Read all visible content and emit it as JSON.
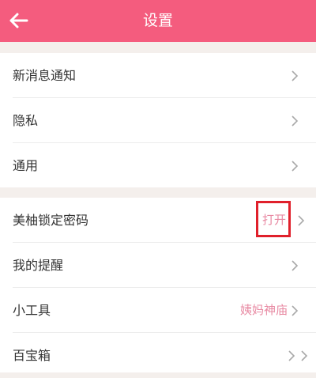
{
  "header": {
    "title": "设置",
    "back_icon": "arrow-left-icon",
    "color": "#f45c7e"
  },
  "groups": [
    {
      "items": [
        {
          "label": "新消息通知"
        },
        {
          "label": "隐私"
        },
        {
          "label": "通用"
        }
      ]
    },
    {
      "items": [
        {
          "label": "美柚锁定密码",
          "value": "打开"
        },
        {
          "label": "我的提醒"
        },
        {
          "label": "小工具",
          "value": "姨妈神庙"
        },
        {
          "label": "百宝箱"
        }
      ]
    }
  ],
  "icons": {
    "chevron": "chevron-right-icon"
  }
}
